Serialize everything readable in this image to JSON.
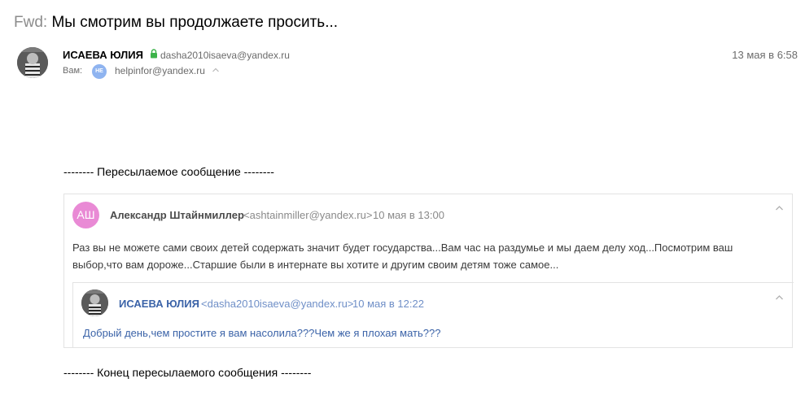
{
  "subject": {
    "prefix": "Fwd:",
    "text": "Мы смотрим вы продолжаете просить..."
  },
  "header": {
    "sender_name": "ИСАЕВА ЮЛИЯ",
    "sender_email": "dasha2010isaeva@yandex.ru",
    "date": "13 мая в 6:58",
    "to_label": "Вам:",
    "to_badge": "НЕ",
    "to_email": "helpinfor@yandex.ru"
  },
  "forward": {
    "begin_label": "-------- Пересылаемое сообщение --------",
    "end_label": "-------- Конец пересылаемого сообщения --------"
  },
  "quoted": {
    "avatar_initials": "АШ",
    "name": "Александр Штайнмиллер",
    "email": "<ashtainmiller@yandex.ru>",
    "date": "10 мая в 13:00",
    "body": "Раз вы не можете сами своих детей содержать значит будет государства...Вам час на раздумье и мы даем делу ход...Посмотрим ваш выбор,что вам дороже...Старшие были в интернате вы хотите и другим своим детям тоже самое..."
  },
  "nested": {
    "name": "ИСАЕВА ЮЛИЯ",
    "email": "<dasha2010isaeva@yandex.ru>",
    "date": "10 мая в 12:22",
    "body": "Добрый день,чем простите я вам насолила???Чем же я плохая мать???"
  },
  "colors": {
    "initials_avatar": "#e98ad5",
    "to_badge": "#8fb4f0",
    "nested_text": "#3b63a8",
    "lock": "#3cb34a"
  }
}
